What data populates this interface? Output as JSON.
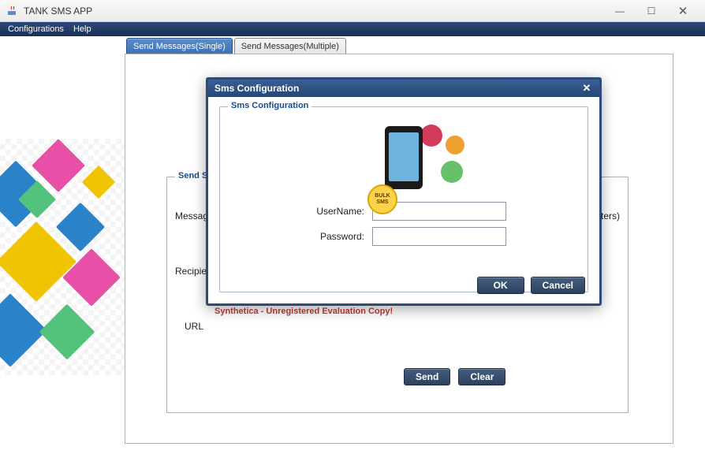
{
  "window": {
    "title": "TANK SMS APP"
  },
  "menu": {
    "configurations": "Configurations",
    "help": "Help"
  },
  "tabs": {
    "single": "Send Messages(Single)",
    "multiple": "Send Messages(Multiple)"
  },
  "form": {
    "groupTitle": "Send SMS",
    "messageLabel": "Message",
    "recipientLabel": "Recipient",
    "urlLabel": "URL",
    "charHint": "characters)",
    "sendLabel": "Send",
    "clearLabel": "Clear"
  },
  "watermark": "Synthetica - Unregistered Evaluation Copy!",
  "dialog": {
    "title": "Sms Configuration",
    "groupTitle": "Sms Configuration",
    "usernameLabel": "UserName:",
    "passwordLabel": "Password:",
    "usernameValue": "",
    "passwordValue": "",
    "ok": "OK",
    "cancel": "Cancel",
    "bannerText": "BULK SMS"
  }
}
